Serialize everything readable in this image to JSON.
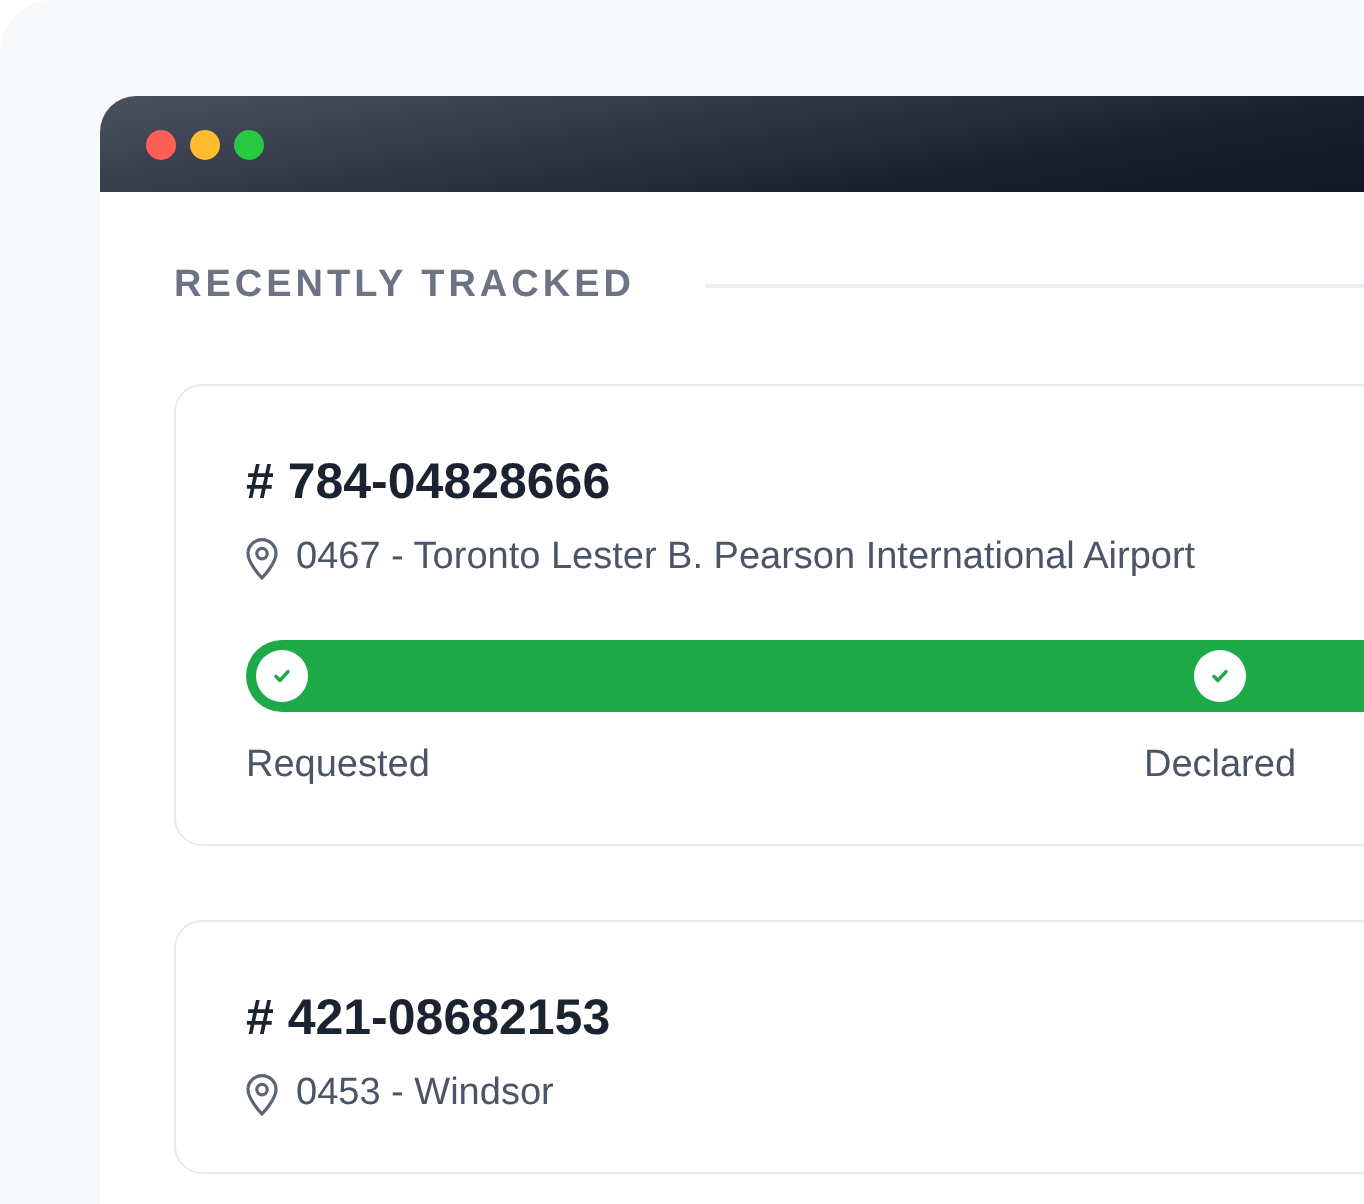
{
  "heading": "RECENTLY TRACKED",
  "shipments": [
    {
      "number": "# 784-04828666",
      "location": "0467 - Toronto Lester B. Pearson International Airport",
      "steps": [
        {
          "label": "Requested",
          "done": true
        },
        {
          "label": "Declared",
          "done": true
        }
      ]
    },
    {
      "number": "# 421-08682153",
      "location": "0453 - Windsor"
    }
  ]
}
